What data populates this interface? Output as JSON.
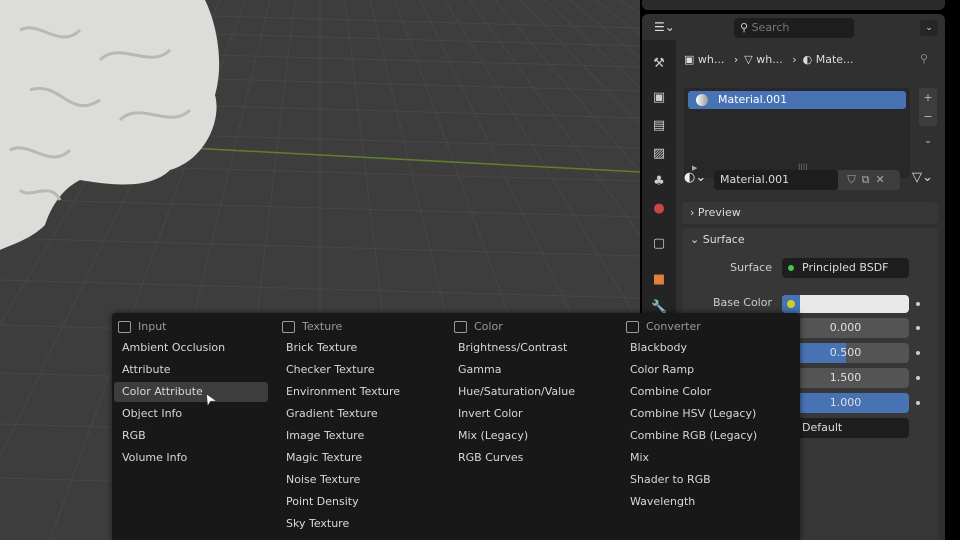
{
  "properties": {
    "search_placeholder": "Search",
    "breadcrumb": [
      "wh...",
      "wh...",
      "Mate..."
    ],
    "material_slots": [
      "Material.001"
    ],
    "material_name": "Material.001",
    "panels": {
      "preview": "Preview",
      "surface": "Surface"
    },
    "surface_label": "Surface",
    "surface_value": "Principled BSDF",
    "surface_color": "#3fcb4a",
    "base_color_label": "Base Color",
    "base_color_value": "#e8e8e8",
    "fields": [
      {
        "value": "0.000",
        "fill": 0
      },
      {
        "value": "0.500",
        "fill": 0.5
      },
      {
        "value": "1.500",
        "fill": 0
      },
      {
        "value": "1.000",
        "fill": 1
      }
    ],
    "dropdown_value": "Default",
    "accent": "#4772b3"
  },
  "add_menu": {
    "columns": [
      {
        "title": "Input",
        "items": [
          "Ambient Occlusion",
          "Attribute",
          "Color Attribute",
          "Object Info",
          "RGB",
          "Volume Info"
        ],
        "highlighted": "Color Attribute"
      },
      {
        "title": "Texture",
        "items": [
          "Brick Texture",
          "Checker Texture",
          "Environment Texture",
          "Gradient Texture",
          "Image Texture",
          "Magic Texture",
          "Noise Texture",
          "Point Density",
          "Sky Texture"
        ]
      },
      {
        "title": "Color",
        "items": [
          "Brightness/Contrast",
          "Gamma",
          "Hue/Saturation/Value",
          "Invert Color",
          "Mix (Legacy)",
          "RGB Curves"
        ]
      },
      {
        "title": "Converter",
        "items": [
          "Blackbody",
          "Color Ramp",
          "Combine Color",
          "Combine HSV (Legacy)",
          "Combine RGB (Legacy)",
          "Mix",
          "Shader to RGB",
          "Wavelength"
        ]
      }
    ]
  }
}
